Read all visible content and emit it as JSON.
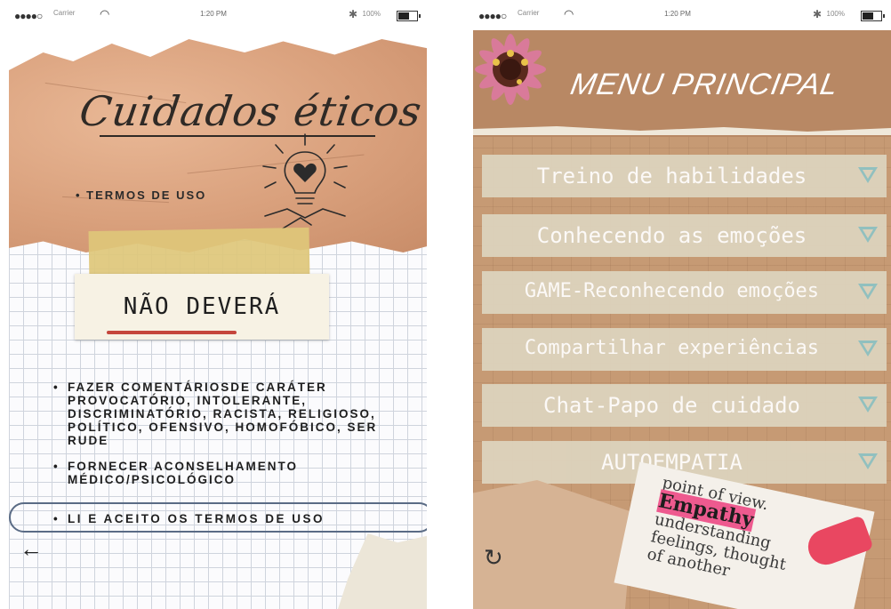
{
  "status_bar": {
    "carrier": "Carrier",
    "time": "1:20 PM",
    "battery": "100%"
  },
  "left_screen": {
    "title": "Cuidados éticos",
    "terms_item": "TERMOS DE USO",
    "must_not_heading": "NÃO DEVERÁ",
    "bullets": [
      "FAZER COMENTÁRIOSDE CARÁTER PROVOCATÓRIO, INTOLERANTE, DISCRIMINATÓRIO, RACISTA, RELIGIOSO, POLÍTICO, OFENSIVO, HOMOFÓBICO, SER RUDE",
      "FORNECER ACONSELHAMENTO MÉDICO/PSICOLÓGICO"
    ],
    "accept_button": "LI E ACEITO OS TERMOS DE USO",
    "back_icon": "arrow-left-icon"
  },
  "right_screen": {
    "title": "MENU PRINCIPAL",
    "menu_items": [
      {
        "label": "Treino de habilidades"
      },
      {
        "label": "Conhecendo as emoções"
      },
      {
        "label": "GAME-Reconhecendo emoções"
      },
      {
        "label": "Compartilhar experiências"
      },
      {
        "label": "Chat-Papo de cuidado"
      },
      {
        "label": "AUTOEMPATIA"
      }
    ],
    "empathy_image_text": [
      "point of view.",
      "Empathy",
      "understanding",
      "feelings, thought",
      "of another"
    ],
    "refresh_icon": "refresh-icon"
  },
  "colors": {
    "kraft": "#d9a07c",
    "tape": "#dec77a",
    "accent_red": "#c5463c",
    "accept_border": "#5a6b85",
    "menu_bg": "#c69a74",
    "menu_item": "#ddd3bd",
    "arrow_teal": "#8fc3c4"
  }
}
